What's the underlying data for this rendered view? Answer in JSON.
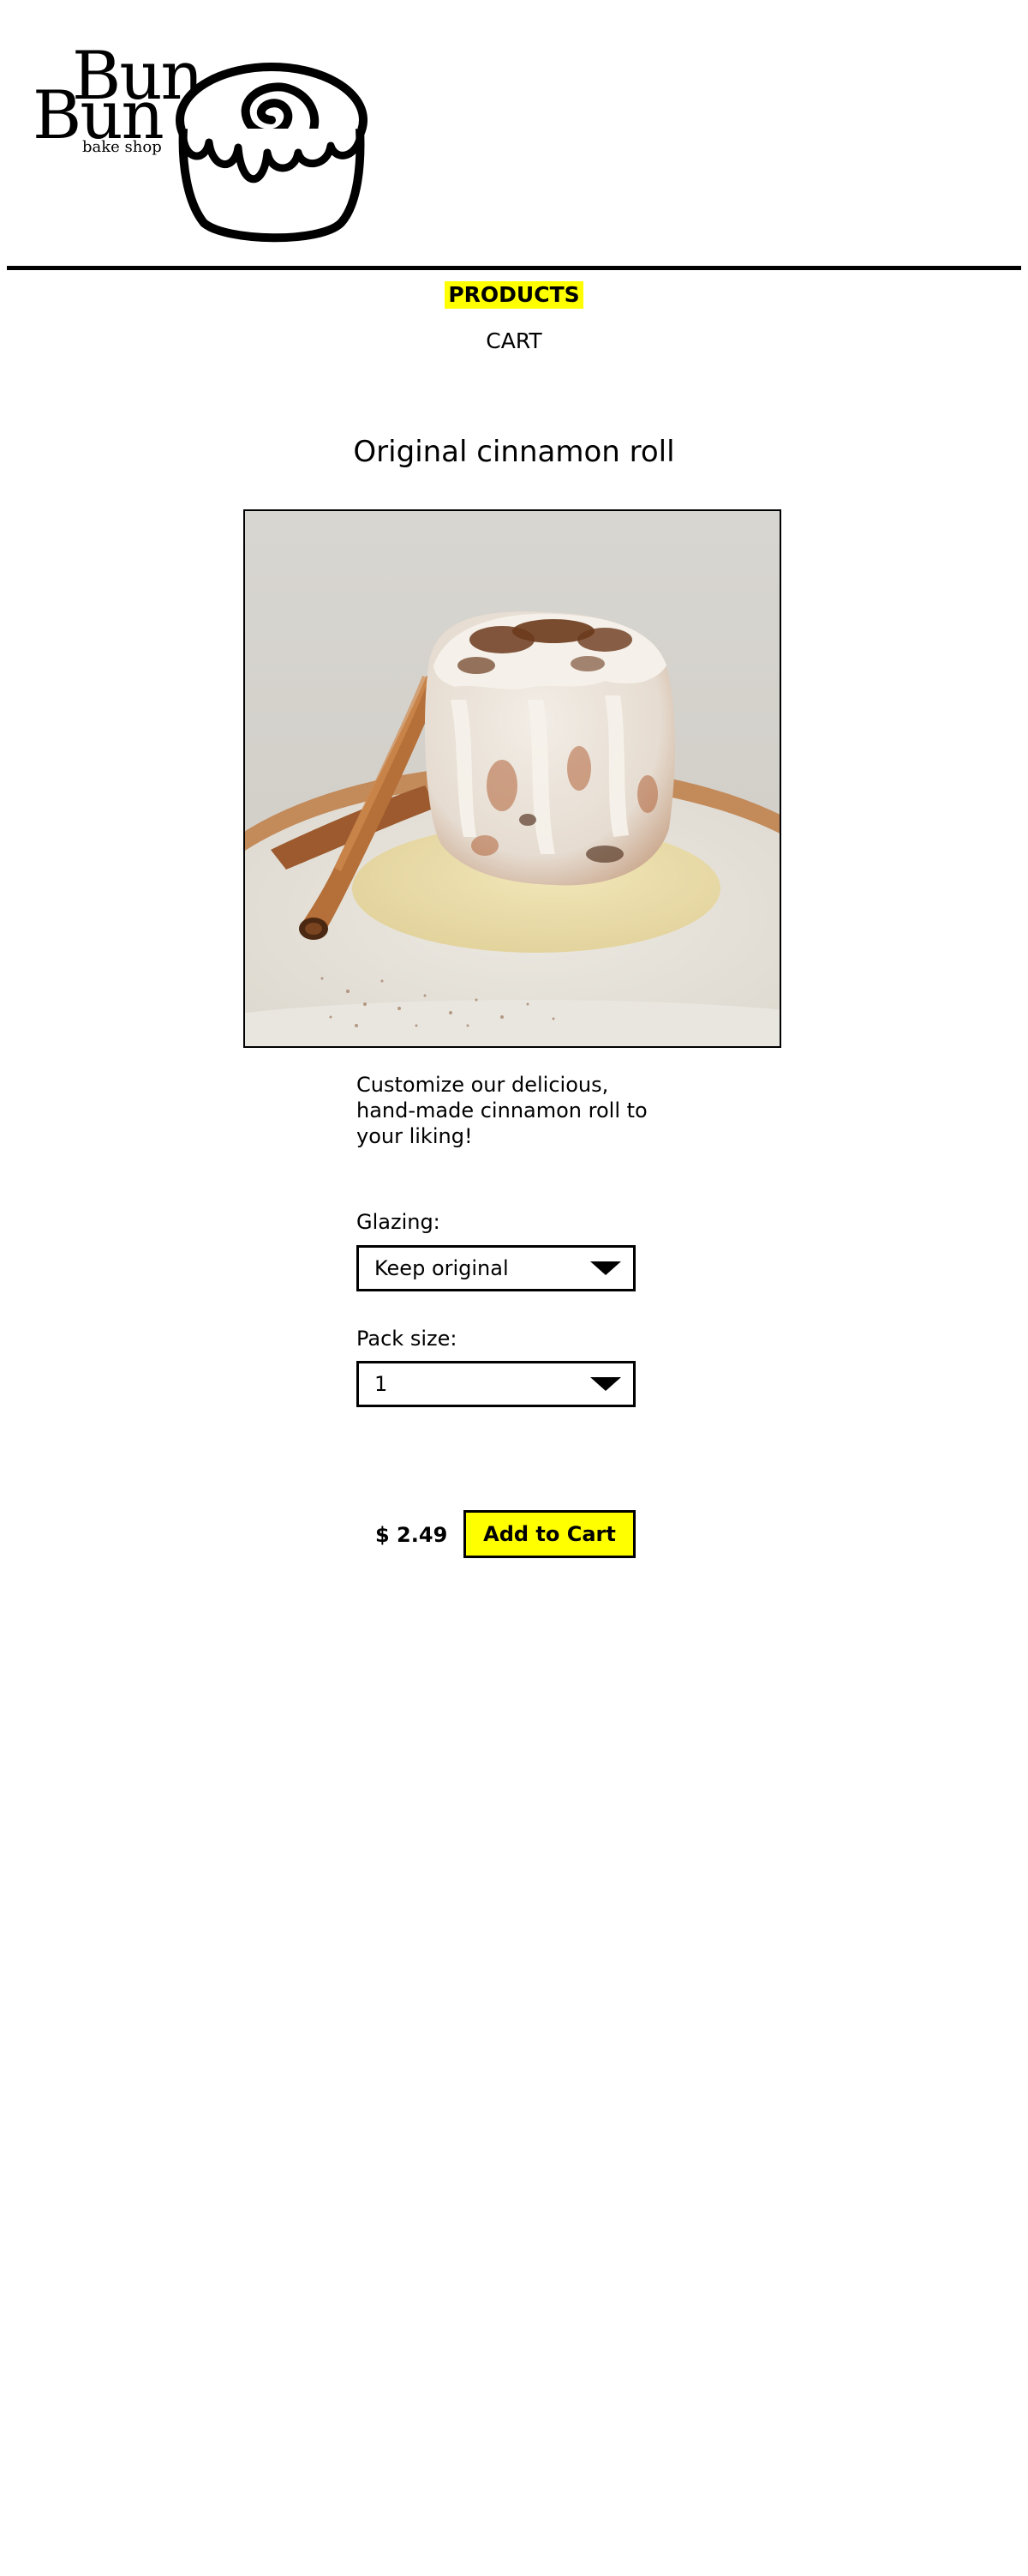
{
  "logo": {
    "line1": "Bun",
    "line2": "Bun",
    "subtitle": "bake shop"
  },
  "nav": {
    "products": "PRODUCTS",
    "cart": "CART"
  },
  "product": {
    "title": "Original cinnamon roll",
    "description": "Customize our delicious, hand-made cinnamon roll to your liking!",
    "glazing_label": "Glazing:",
    "glazing_value": "Keep original",
    "pack_size_label": "Pack size:",
    "pack_size_value": "1",
    "price": "$ 2.49",
    "add_to_cart": "Add to Cart"
  },
  "colors": {
    "accent": "#ffff00",
    "text": "#000000",
    "background": "#ffffff"
  }
}
